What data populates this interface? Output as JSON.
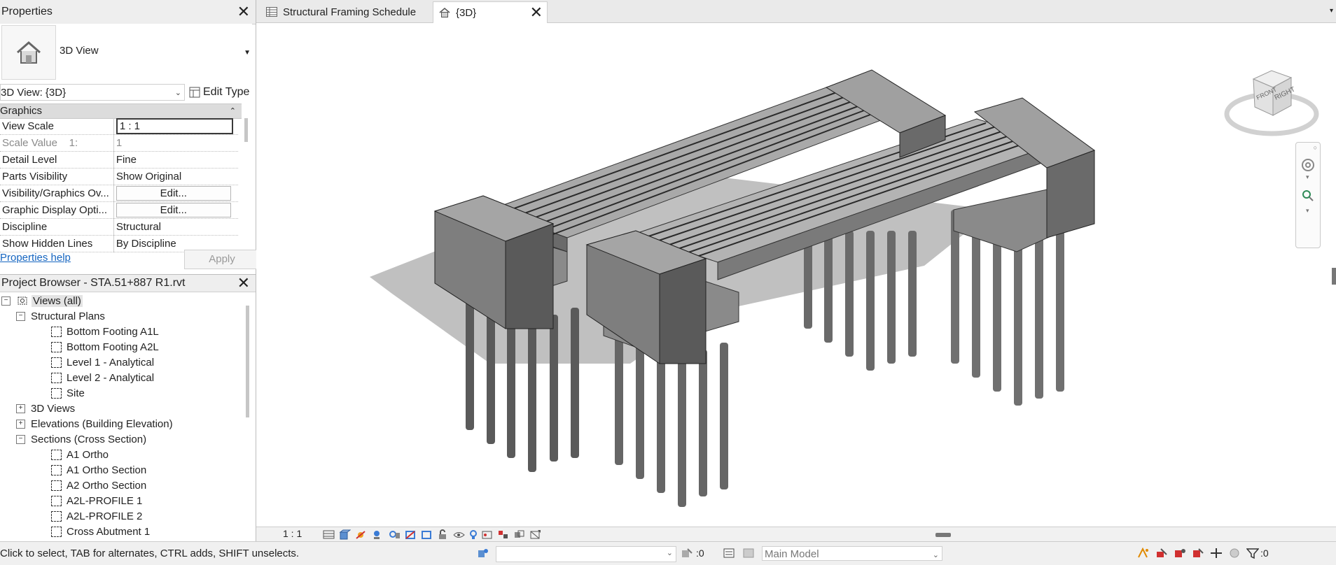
{
  "properties": {
    "title": "Properties",
    "type_name": "3D View",
    "view_selector": "3D View: {3D}",
    "edit_type": "Edit Type",
    "group": "Graphics",
    "rows": [
      {
        "name": "View Scale",
        "value": "1 : 1",
        "kind": "input"
      },
      {
        "name": "Scale Value    1:",
        "value": "1",
        "kind": "dim"
      },
      {
        "name": "Detail Level",
        "value": "Fine",
        "kind": "text"
      },
      {
        "name": "Parts Visibility",
        "value": "Show Original",
        "kind": "text"
      },
      {
        "name": "Visibility/Graphics Ov...",
        "value": "Edit...",
        "kind": "button"
      },
      {
        "name": "Graphic Display Opti...",
        "value": "Edit...",
        "kind": "button"
      },
      {
        "name": "Discipline",
        "value": "Structural",
        "kind": "text"
      },
      {
        "name": "Show Hidden Lines",
        "value": "By Discipline",
        "kind": "text"
      }
    ],
    "help_link": "Properties help",
    "apply": "Apply"
  },
  "browser": {
    "title": "Project Browser - STA.51+887 R1.rvt",
    "root": "Views (all)",
    "structural_plans": "Structural Plans",
    "plans": [
      "Bottom Footing A1L",
      "Bottom Footing A2L",
      "Level 1 - Analytical",
      "Level 2 - Analytical",
      "Site"
    ],
    "views_3d": "3D Views",
    "elevations": "Elevations (Building Elevation)",
    "sections": "Sections (Cross Section)",
    "section_items": [
      "A1 Ortho",
      "A1 Ortho Section",
      "A2 Ortho Section",
      "A2L-PROFILE 1",
      "A2L-PROFILE 2",
      "Cross Abutment 1"
    ]
  },
  "tabs": [
    {
      "label": "Structural Framing Schedule",
      "active": false
    },
    {
      "label": "{3D}",
      "active": true
    }
  ],
  "viewcube": {
    "face_front": "FRONT",
    "face_right": "RIGHT"
  },
  "view_control": {
    "scale": "1 : 1"
  },
  "status": {
    "message": "Click to select, TAB for alternates, CTRL adds, SHIFT unselects.",
    "worksets_count": ":0",
    "model": "Main Model",
    "filter_count": ":0"
  }
}
